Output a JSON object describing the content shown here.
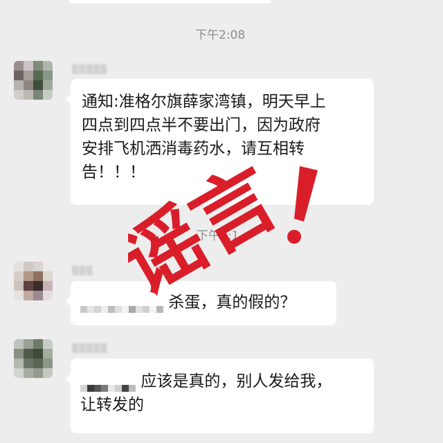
{
  "chat": {
    "timestamps": [
      "下午2:08",
      "下午2:1"
    ],
    "messages": [
      {
        "lines": [
          "通知:准格尔旗薛家湾镇，明天早上",
          "四点到四点半不要出门，因为政府",
          "安排飞机洒消毒药水，请互相转",
          "告！！！"
        ]
      },
      {
        "text": "杀蛋，真的假的？"
      },
      {
        "line1": "应该是真的，别人发给我，",
        "line2": "让转发的"
      }
    ]
  },
  "overlay": {
    "stamp_text": "谣言",
    "stamp_mark": "!",
    "color": "#d91e2a"
  },
  "colors": {
    "background": "#ededed",
    "bubble": "#ffffff",
    "timestamp": "#8e8e8e"
  }
}
